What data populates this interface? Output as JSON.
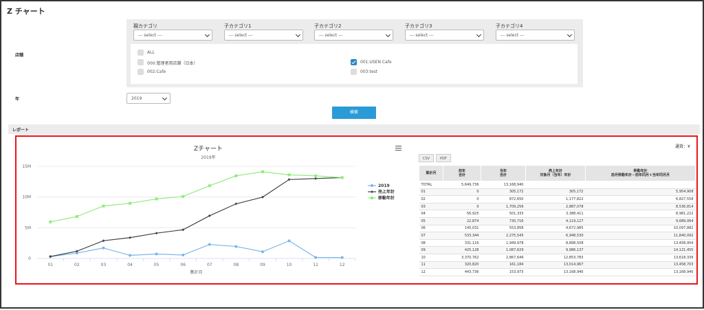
{
  "page": {
    "title": "Z チャート"
  },
  "filters": {
    "categories": [
      {
        "label": "親カテゴリ",
        "value": "--- select ---"
      },
      {
        "label": "子カテゴリ1",
        "value": "--- select ---"
      },
      {
        "label": "子カテゴリ2",
        "value": "--- select ---"
      },
      {
        "label": "子カテゴリ3",
        "value": "--- select ---"
      },
      {
        "label": "子カテゴリ4",
        "value": "--- select ---"
      }
    ],
    "store_label": "店舗",
    "stores": [
      {
        "label": "ALL",
        "checked": false
      },
      {
        "label": "000:管理者用店舗（日本）",
        "checked": false
      },
      {
        "label": "002:Cafe",
        "checked": false
      },
      {
        "label": "001:USEN Cafe",
        "checked": true
      },
      {
        "label": "003:test",
        "checked": false
      }
    ],
    "year_label": "年",
    "year_value": "2019",
    "search_label": "検索"
  },
  "report": {
    "label": "レポート"
  },
  "chart_data": {
    "type": "line",
    "title": "Zチャート",
    "subtitle": "2019年",
    "xlabel": "集計月",
    "ylabel": "",
    "categories": [
      "01",
      "02",
      "03",
      "04",
      "05",
      "06",
      "07",
      "08",
      "09",
      "10",
      "11",
      "12"
    ],
    "yticks": [
      "0",
      "5M",
      "10M",
      "15M"
    ],
    "ylim": [
      0,
      15000000
    ],
    "grid": true,
    "legend_position": "right",
    "series": [
      {
        "name": "2019",
        "color": "#7cb5ec",
        "values": [
          305172,
          872650,
          1709256,
          501333,
          730716,
          553858,
          2275545,
          1949978,
          1087629,
          2867646,
          161184,
          153973
        ]
      },
      {
        "name": "売上年計",
        "color": "#434348",
        "values": [
          305172,
          1177822,
          2887078,
          3388411,
          4119127,
          4672985,
          6948530,
          8898508,
          9986137,
          12853783,
          13014967,
          13168940
        ]
      },
      {
        "name": "移動年計",
        "color": "#90ed7d",
        "values": [
          5954908,
          6827558,
          8536814,
          8981222,
          9689064,
          10097882,
          11840092,
          13458954,
          14121455,
          13618339,
          13458706,
          13168940
        ]
      }
    ]
  },
  "table": {
    "unit": "通貨：¥",
    "buttons": [
      "CSV",
      "PDF"
    ],
    "headers": [
      [
        "集計月"
      ],
      [
        "前年",
        "合計"
      ],
      [
        "当年",
        "合計"
      ],
      [
        "売上年計",
        "対象月（当年）年計"
      ],
      [
        "移動年計",
        "前月移動年計－前年同月＋当年同月月"
      ]
    ],
    "rows": [
      [
        "TOTAL",
        "5,649,736",
        "13,168,940",
        "",
        ""
      ],
      [
        "01",
        "0",
        "305,172",
        "305,172",
        "5,954,908"
      ],
      [
        "02",
        "0",
        "872,650",
        "1,177,822",
        "6,827,558"
      ],
      [
        "03",
        "0",
        "1,709,256",
        "2,887,078",
        "8,536,814"
      ],
      [
        "04",
        "56,925",
        "501,333",
        "3,388,411",
        "8,981,222"
      ],
      [
        "05",
        "22,874",
        "730,716",
        "4,119,127",
        "9,689,064"
      ],
      [
        "06",
        "145,031",
        "553,858",
        "4,672,985",
        "10,097,882"
      ],
      [
        "07",
        "533,344",
        "2,275,545",
        "6,948,530",
        "11,840,092"
      ],
      [
        "08",
        "331,116",
        "1,949,978",
        "8,898,508",
        "13,458,954"
      ],
      [
        "09",
        "425,128",
        "1,087,629",
        "9,986,137",
        "14,121,455"
      ],
      [
        "10",
        "3,370,762",
        "2,867,646",
        "12,853,783",
        "13,618,339"
      ],
      [
        "11",
        "320,820",
        "161,184",
        "13,014,967",
        "13,458,703"
      ],
      [
        "12",
        "443,736",
        "153,973",
        "13,168,940",
        "13,168,940"
      ]
    ]
  }
}
